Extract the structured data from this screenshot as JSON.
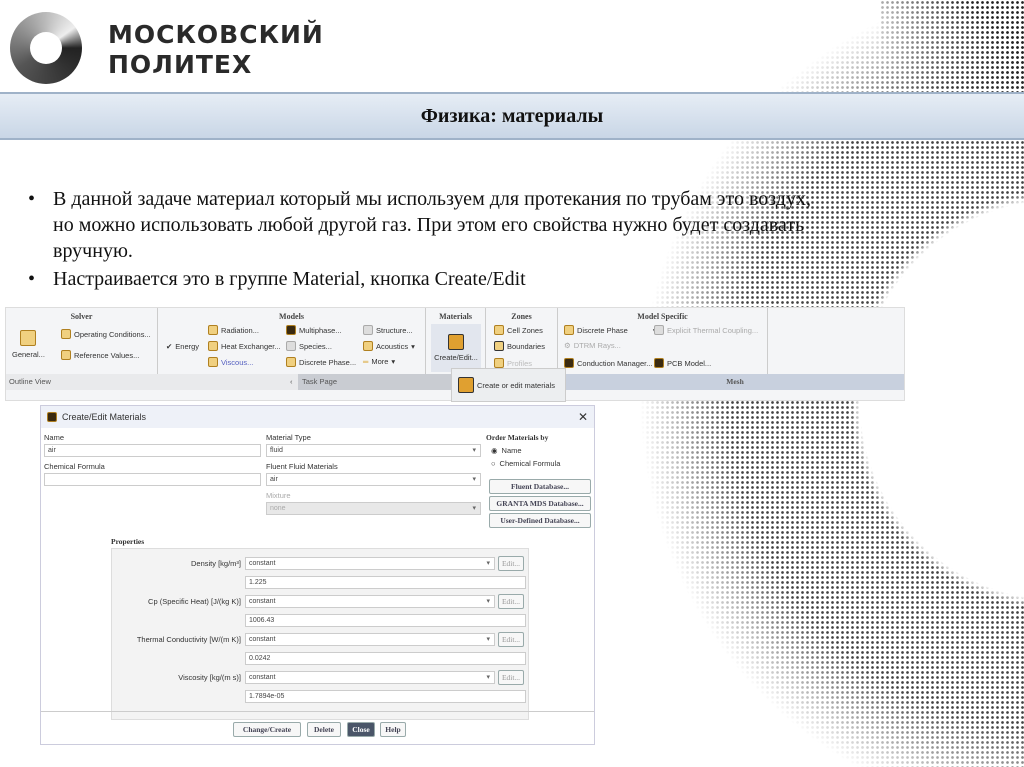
{
  "logo": {
    "line1": "МОСКОВСКИЙ",
    "line2": "ПОЛИТЕХ"
  },
  "slide": {
    "title": "Физика: материалы",
    "bullets": [
      "В данной задаче материал который мы используем для протекания по трубам это воздух, но можно использовать любой другой газ. При этом его свойства нужно будет создавать вручную.",
      "Настраивается это в группе Material, кнопка Create/Edit"
    ]
  },
  "ribbon": {
    "solver": {
      "title": "Solver",
      "general": "General...",
      "operating": "Operating Conditions...",
      "reference": "Reference Values..."
    },
    "models": {
      "title": "Models",
      "energy": "Energy",
      "radiation": "Radiation...",
      "heat_exchanger": "Heat Exchanger...",
      "viscous": "Viscous...",
      "multiphase": "Multiphase...",
      "species": "Species...",
      "discrete_phase": "Discrete Phase...",
      "structure": "Structure...",
      "acoustics": "Acoustics",
      "more": "More"
    },
    "materials": {
      "title": "Materials",
      "create_edit": "Create/Edit...",
      "tooltip": "Create or edit materials"
    },
    "zones": {
      "title": "Zones",
      "cell_zones": "Cell Zones",
      "boundaries": "Boundaries",
      "profiles": "Profiles"
    },
    "model_specific": {
      "title": "Model Specific",
      "discrete_phase": "Discrete Phase",
      "explicit": "Explicit Thermal Coupling...",
      "dtrm": "DTRM Rays...",
      "conduction": "Conduction Manager...",
      "pcb": "PCB Model..."
    },
    "outline_view": "Outline View",
    "task_page": "Task Page",
    "mesh": "Mesh"
  },
  "dialog": {
    "title": "Create/Edit Materials",
    "name_label": "Name",
    "name_value": "air",
    "formula_label": "Chemical Formula",
    "formula_value": "",
    "type_label": "Material Type",
    "type_value": "fluid",
    "fluid_label": "Fluent Fluid Materials",
    "fluid_value": "air",
    "mixture_label": "Mixture",
    "mixture_value": "none",
    "order_label": "Order Materials by",
    "order_options": [
      "Name",
      "Chemical Formula"
    ],
    "order_selected": "Name",
    "db_buttons": [
      "Fluent Database...",
      "GRANTA MDS Database...",
      "User-Defined Database..."
    ],
    "properties_label": "Properties",
    "properties": [
      {
        "label": "Density [kg/m³]",
        "method": "constant",
        "value": "1.225"
      },
      {
        "label": "Cp (Specific Heat) [J/(kg K)]",
        "method": "constant",
        "value": "1006.43"
      },
      {
        "label": "Thermal Conductivity [W/(m K)]",
        "method": "constant",
        "value": "0.0242"
      },
      {
        "label": "Viscosity [kg/(m s)]",
        "method": "constant",
        "value": "1.7894e-05"
      }
    ],
    "edit_label": "Edit...",
    "buttons": {
      "change": "Change/Create",
      "delete": "Delete",
      "close": "Close",
      "help": "Help"
    }
  }
}
